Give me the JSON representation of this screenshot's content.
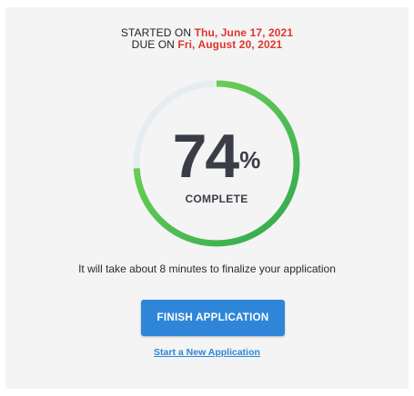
{
  "dates": {
    "started_label": "STARTED ON",
    "started_value": "Thu, June 17, 2021",
    "due_label": "DUE ON",
    "due_value": "Fri, August 20, 2021"
  },
  "progress": {
    "percent": 74,
    "percent_text": "74",
    "percent_sign": "%",
    "label": "COMPLETE"
  },
  "estimate_text": "It will take about 8 minutes to finalize your application",
  "actions": {
    "finish_label": "FINISH APPLICATION",
    "new_link_label": "Start a New Application"
  },
  "colors": {
    "accent_blue": "#2f86d8",
    "date_red": "#e0352d",
    "progress_green_start": "#7ed957",
    "progress_green_end": "#2ea84f",
    "track": "#e6edf1",
    "panel": "#f4f4f4"
  }
}
